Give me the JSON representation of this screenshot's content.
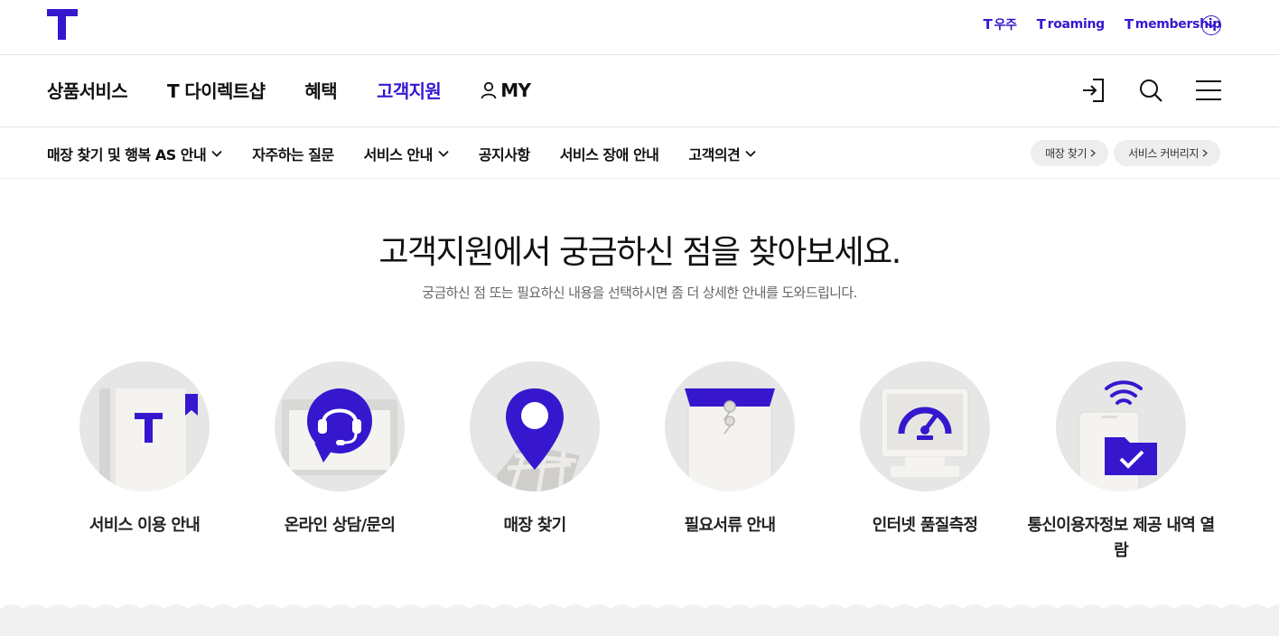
{
  "util": {
    "links": [
      {
        "mark": "T",
        "label": "우주"
      },
      {
        "mark": "T",
        "label": "roaming"
      },
      {
        "mark": "T",
        "label": "membership"
      }
    ]
  },
  "gnb": {
    "items": [
      {
        "label": "상품서비스",
        "active": false
      },
      {
        "label": "T 다이렉트샵",
        "active": false
      },
      {
        "label": "혜택",
        "active": false
      },
      {
        "label": "고객지원",
        "active": true
      },
      {
        "label": "MY",
        "active": false
      }
    ]
  },
  "lnb": {
    "items": [
      {
        "label": "매장 찾기 및 행복 AS 안내",
        "dropdown": true
      },
      {
        "label": "자주하는 질문",
        "dropdown": false
      },
      {
        "label": "서비스 안내",
        "dropdown": true
      },
      {
        "label": "공지사항",
        "dropdown": false
      },
      {
        "label": "서비스 장애 안내",
        "dropdown": false
      },
      {
        "label": "고객의견",
        "dropdown": true
      }
    ],
    "pills": [
      {
        "label": "매장 찾기"
      },
      {
        "label": "서비스 커버리지"
      }
    ]
  },
  "hero": {
    "title": "고객지원에서 궁금하신 점을 찾아보세요.",
    "subtitle": "궁금하신 점 또는 필요하신 내용을 선택하시면 좀 더 상세한 안내를 도와드립니다."
  },
  "cards": [
    {
      "label": "서비스 이용 안내",
      "icon": "guide-book-icon"
    },
    {
      "label": "온라인 상담/문의",
      "icon": "headset-chat-icon"
    },
    {
      "label": "매장 찾기",
      "icon": "map-pin-icon"
    },
    {
      "label": "필요서류 안내",
      "icon": "document-envelope-icon"
    },
    {
      "label": "인터넷 품질측정",
      "icon": "speed-gauge-icon"
    },
    {
      "label": "통신이용자정보 제공 내역 열람",
      "icon": "wifi-folder-check-icon"
    }
  ],
  "colors": {
    "brand": "#3617ce",
    "text": "#111111",
    "circle": "#e6e6e6"
  }
}
